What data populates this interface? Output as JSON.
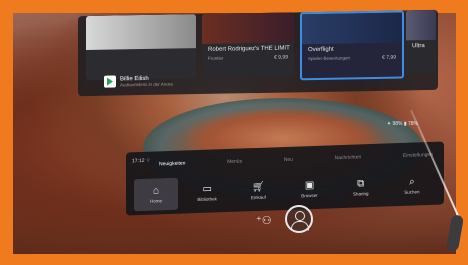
{
  "store": {
    "cards": [
      {
        "title": "Billie Eilish",
        "subtitle": "",
        "price": ""
      },
      {
        "title": "Robert Rodriguez's THE LIMIT",
        "subtitle": "Frontier",
        "price": "€ 9,99"
      },
      {
        "title": "Overflight",
        "subtitle": "Spieler-Bewertungen",
        "price": "€ 7,99"
      },
      {
        "title": "Ultra",
        "subtitle": "",
        "price": ""
      }
    ],
    "app": {
      "title": "Billie Eilish",
      "subtitle": "Audioerlebnis in der Arena"
    }
  },
  "status": {
    "right": "✦ 98%   ▮ 78%"
  },
  "nav": {
    "time": "17:12  ⌔",
    "tabs": [
      "Neuigkeiten",
      "Menüs",
      "Neu",
      "Nachrichten",
      "Einstellungen"
    ],
    "active_tab": 0,
    "buttons": [
      {
        "icon": "home-icon",
        "glyph": "⌂",
        "label": "Home"
      },
      {
        "icon": "library-icon",
        "glyph": "▭",
        "label": "Bibliothek"
      },
      {
        "icon": "cart-icon",
        "glyph": "🛒︎",
        "label": "Einkauf"
      },
      {
        "icon": "browser-icon",
        "glyph": "▣",
        "label": "Browser"
      },
      {
        "icon": "sharing-icon",
        "glyph": "⧉",
        "label": "Sharing"
      },
      {
        "icon": "search-icon",
        "glyph": "⌕",
        "label": "Suchen"
      }
    ],
    "active_button": 0
  },
  "bottom": {
    "addfriend_glyph": "⁺⚇"
  }
}
